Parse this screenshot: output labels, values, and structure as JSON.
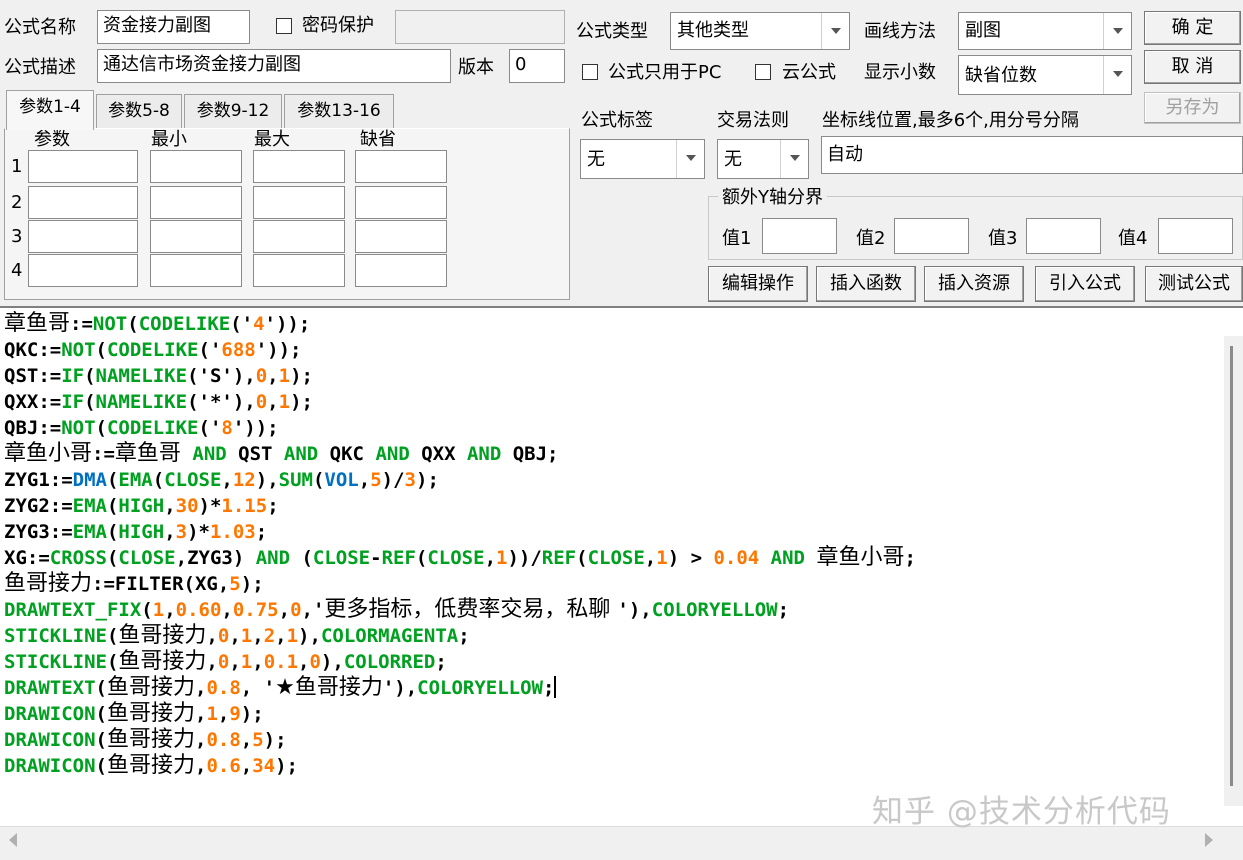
{
  "formula": {
    "name_label": "公式名称",
    "name_value": "资金接力副图",
    "password_label": "密码保护",
    "desc_label": "公式描述",
    "desc_value": "通达信市场资金接力副图",
    "version_label": "版本",
    "version_value": "0",
    "type_label": "公式类型",
    "type_value": "其他类型",
    "draw_label": "画线方法",
    "draw_value": "副图",
    "pc_only_label": "公式只用于PC",
    "cloud_label": "云公式",
    "decimal_label": "显示小数",
    "decimal_value": "缺省位数",
    "tag_label": "公式标签",
    "tag_value": "无",
    "rule_label": "交易法则",
    "rule_value": "无",
    "axis_label": "坐标线位置,最多6个,用分号分隔",
    "axis_value": "自动",
    "yaxis_group_label": "额外Y轴分界",
    "yvals": [
      "值1",
      "值2",
      "值3",
      "值4"
    ]
  },
  "buttons": {
    "ok": "确  定",
    "cancel": "取  消",
    "save_as": "另存为",
    "edit_ops": "编辑操作",
    "insert_func": "插入函数",
    "insert_res": "插入资源",
    "import_formula": "引入公式",
    "test_formula": "测试公式"
  },
  "tabs": [
    "参数1-4",
    "参数5-8",
    "参数9-12",
    "参数13-16"
  ],
  "params": {
    "headers": [
      "参数",
      "最小",
      "最大",
      "缺省"
    ],
    "rows": [
      "1",
      "2",
      "3",
      "4"
    ]
  },
  "code_lines": [
    [
      [
        "c-p cjk",
        "章鱼哥"
      ],
      [
        "c-b",
        ":="
      ],
      [
        "c-g",
        "NOT"
      ],
      [
        "c-b",
        "("
      ],
      [
        "c-g",
        "CODELIKE"
      ],
      [
        "c-b",
        "('"
      ],
      [
        "c-o",
        "4"
      ],
      [
        "c-b",
        "'));"
      ]
    ],
    [
      [
        "c-b",
        "QKC:="
      ],
      [
        "c-g",
        "NOT"
      ],
      [
        "c-b",
        "("
      ],
      [
        "c-g",
        "CODELIKE"
      ],
      [
        "c-b",
        "('"
      ],
      [
        "c-o",
        "688"
      ],
      [
        "c-b",
        "'));"
      ]
    ],
    [
      [
        "c-b",
        "QST:="
      ],
      [
        "c-g",
        "IF"
      ],
      [
        "c-b",
        "("
      ],
      [
        "c-g",
        "NAMELIKE"
      ],
      [
        "c-b",
        "('S'),"
      ],
      [
        "c-o",
        "0"
      ],
      [
        "c-b",
        ","
      ],
      [
        "c-o",
        "1"
      ],
      [
        "c-b",
        ");"
      ]
    ],
    [
      [
        "c-b",
        "QXX:="
      ],
      [
        "c-g",
        "IF"
      ],
      [
        "c-b",
        "("
      ],
      [
        "c-g",
        "NAMELIKE"
      ],
      [
        "c-b",
        "('*'),"
      ],
      [
        "c-o",
        "0"
      ],
      [
        "c-b",
        ","
      ],
      [
        "c-o",
        "1"
      ],
      [
        "c-b",
        ");"
      ]
    ],
    [
      [
        "c-b",
        "QBJ:="
      ],
      [
        "c-g",
        "NOT"
      ],
      [
        "c-b",
        "("
      ],
      [
        "c-g",
        "CODELIKE"
      ],
      [
        "c-b",
        "('"
      ],
      [
        "c-o",
        "8"
      ],
      [
        "c-b",
        "'));"
      ]
    ],
    [
      [
        "c-p cjk",
        "章鱼小哥"
      ],
      [
        "c-b",
        ":="
      ],
      [
        "c-p cjk",
        "章鱼哥"
      ],
      [
        "c-b",
        " "
      ],
      [
        "c-g",
        "AND"
      ],
      [
        "c-b",
        " QST "
      ],
      [
        "c-g",
        "AND"
      ],
      [
        "c-b",
        " QKC "
      ],
      [
        "c-g",
        "AND"
      ],
      [
        "c-b",
        " QXX "
      ],
      [
        "c-g",
        "AND"
      ],
      [
        "c-b",
        " QBJ;"
      ]
    ],
    [
      [
        "c-b",
        "ZYG1:="
      ],
      [
        "c-u",
        "DMA"
      ],
      [
        "c-b",
        "("
      ],
      [
        "c-g",
        "EMA"
      ],
      [
        "c-b",
        "("
      ],
      [
        "c-g",
        "CLOSE"
      ],
      [
        "c-b",
        ","
      ],
      [
        "c-o",
        "12"
      ],
      [
        "c-b",
        "),"
      ],
      [
        "c-g",
        "SUM"
      ],
      [
        "c-b",
        "("
      ],
      [
        "c-u",
        "VOL"
      ],
      [
        "c-b",
        ","
      ],
      [
        "c-o",
        "5"
      ],
      [
        "c-b",
        ")/"
      ],
      [
        "c-o",
        "3"
      ],
      [
        "c-b",
        ");"
      ]
    ],
    [
      [
        "c-b",
        "ZYG2:="
      ],
      [
        "c-g",
        "EMA"
      ],
      [
        "c-b",
        "("
      ],
      [
        "c-g",
        "HIGH"
      ],
      [
        "c-b",
        ","
      ],
      [
        "c-o",
        "30"
      ],
      [
        "c-b",
        ")*"
      ],
      [
        "c-o",
        "1.15"
      ],
      [
        "c-b",
        ";"
      ]
    ],
    [
      [
        "c-b",
        "ZYG3:="
      ],
      [
        "c-g",
        "EMA"
      ],
      [
        "c-b",
        "("
      ],
      [
        "c-g",
        "HIGH"
      ],
      [
        "c-b",
        ","
      ],
      [
        "c-o",
        "3"
      ],
      [
        "c-b",
        ")*"
      ],
      [
        "c-o",
        "1.03"
      ],
      [
        "c-b",
        ";"
      ]
    ],
    [
      [
        "c-b",
        "XG:="
      ],
      [
        "c-g",
        "CROSS"
      ],
      [
        "c-b",
        "("
      ],
      [
        "c-g",
        "CLOSE"
      ],
      [
        "c-b",
        ",ZYG3) "
      ],
      [
        "c-g",
        "AND"
      ],
      [
        "c-b",
        " ("
      ],
      [
        "c-g",
        "CLOSE"
      ],
      [
        "c-b",
        "-"
      ],
      [
        "c-g",
        "REF"
      ],
      [
        "c-b",
        "("
      ],
      [
        "c-g",
        "CLOSE"
      ],
      [
        "c-b",
        ","
      ],
      [
        "c-o",
        "1"
      ],
      [
        "c-b",
        "))/"
      ],
      [
        "c-g",
        "REF"
      ],
      [
        "c-b",
        "("
      ],
      [
        "c-g",
        "CLOSE"
      ],
      [
        "c-b",
        ","
      ],
      [
        "c-o",
        "1"
      ],
      [
        "c-b",
        ") > "
      ],
      [
        "c-o",
        "0.04"
      ],
      [
        "c-b",
        " "
      ],
      [
        "c-g",
        "AND"
      ],
      [
        "c-b",
        " "
      ],
      [
        "c-p cjk",
        "章鱼小哥"
      ],
      [
        "c-b",
        ";"
      ]
    ],
    [
      [
        "c-p cjk",
        "鱼哥接力"
      ],
      [
        "c-b",
        ":=FILTER(XG,"
      ],
      [
        "c-o",
        "5"
      ],
      [
        "c-b",
        ");"
      ]
    ],
    [
      [
        "c-g",
        "DRAWTEXT_FIX"
      ],
      [
        "c-b",
        "("
      ],
      [
        "c-o",
        "1"
      ],
      [
        "c-b",
        ","
      ],
      [
        "c-o",
        "0.60"
      ],
      [
        "c-b",
        ","
      ],
      [
        "c-o",
        "0.75"
      ],
      [
        "c-b",
        ","
      ],
      [
        "c-o",
        "0"
      ],
      [
        "c-b",
        ",'"
      ],
      [
        "c-p cjk",
        "更多指标，低费率交易，私聊 "
      ],
      [
        "c-b",
        "'),"
      ],
      [
        "c-g",
        "COLORYELLOW"
      ],
      [
        "c-b",
        ";"
      ]
    ],
    [
      [
        "c-g",
        "STICKLINE"
      ],
      [
        "c-b",
        "("
      ],
      [
        "c-p cjk",
        "鱼哥接力"
      ],
      [
        "c-b",
        ","
      ],
      [
        "c-o",
        "0"
      ],
      [
        "c-b",
        ","
      ],
      [
        "c-o",
        "1"
      ],
      [
        "c-b",
        ","
      ],
      [
        "c-o",
        "2"
      ],
      [
        "c-b",
        ","
      ],
      [
        "c-o",
        "1"
      ],
      [
        "c-b",
        "),"
      ],
      [
        "c-g",
        "COLORMAGENTA"
      ],
      [
        "c-b",
        ";"
      ]
    ],
    [
      [
        "c-g",
        "STICKLINE"
      ],
      [
        "c-b",
        "("
      ],
      [
        "c-p cjk",
        "鱼哥接力"
      ],
      [
        "c-b",
        ","
      ],
      [
        "c-o",
        "0"
      ],
      [
        "c-b",
        ","
      ],
      [
        "c-o",
        "1"
      ],
      [
        "c-b",
        ","
      ],
      [
        "c-o",
        "0.1"
      ],
      [
        "c-b",
        ","
      ],
      [
        "c-o",
        "0"
      ],
      [
        "c-b",
        "),"
      ],
      [
        "c-g",
        "COLORRED"
      ],
      [
        "c-b",
        ";"
      ]
    ],
    [
      [
        "c-g",
        "DRAWTEXT"
      ],
      [
        "c-b",
        "("
      ],
      [
        "c-p cjk",
        "鱼哥接力"
      ],
      [
        "c-b",
        ","
      ],
      [
        "c-o",
        "0.8"
      ],
      [
        "c-b",
        ", '"
      ],
      [
        "c-p cjk",
        "★鱼哥接力"
      ],
      [
        "c-b",
        "'),"
      ],
      [
        "c-g",
        "COLORYELLOW"
      ],
      [
        "c-b",
        ";"
      ]
    ],
    [
      [
        "c-g",
        "DRAWICON"
      ],
      [
        "c-b",
        "("
      ],
      [
        "c-p cjk",
        "鱼哥接力"
      ],
      [
        "c-b",
        ","
      ],
      [
        "c-o",
        "1"
      ],
      [
        "c-b",
        ","
      ],
      [
        "c-o",
        "9"
      ],
      [
        "c-b",
        ");"
      ]
    ],
    [
      [
        "c-g",
        "DRAWICON"
      ],
      [
        "c-b",
        "("
      ],
      [
        "c-p cjk",
        "鱼哥接力"
      ],
      [
        "c-b",
        ","
      ],
      [
        "c-o",
        "0.8"
      ],
      [
        "c-b",
        ","
      ],
      [
        "c-o",
        "5"
      ],
      [
        "c-b",
        ");"
      ]
    ],
    [
      [
        "c-g",
        "DRAWICON"
      ],
      [
        "c-b",
        "("
      ],
      [
        "c-p cjk",
        "鱼哥接力"
      ],
      [
        "c-b",
        ","
      ],
      [
        "c-o",
        "0.6"
      ],
      [
        "c-b",
        ","
      ],
      [
        "c-o",
        "34"
      ],
      [
        "c-b",
        ");"
      ]
    ]
  ],
  "watermark": "知乎 @技术分析代码"
}
